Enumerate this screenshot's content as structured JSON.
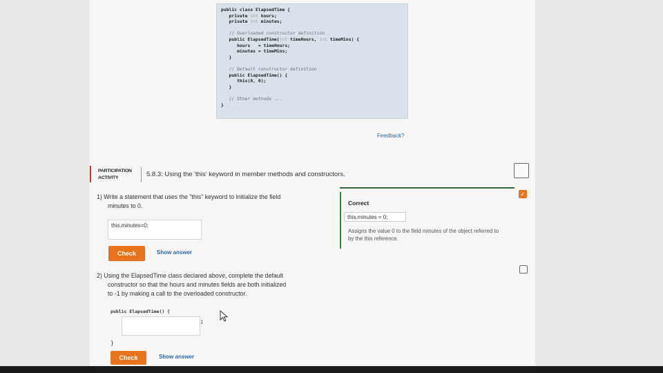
{
  "code": {
    "lines": [
      [
        {
          "t": "public class ElapsedTime {",
          "c": "kw"
        }
      ],
      [
        {
          "t": "   private ",
          "c": "kw"
        },
        {
          "t": "int",
          "c": "ty"
        },
        {
          "t": " hours;",
          "c": "kw"
        }
      ],
      [
        {
          "t": "   private ",
          "c": "kw"
        },
        {
          "t": "int",
          "c": "ty"
        },
        {
          "t": " minutes;",
          "c": "kw"
        }
      ],
      [
        {
          "t": "",
          "c": "kw"
        }
      ],
      [
        {
          "t": "   // Overloaded constructor definition",
          "c": "cm"
        }
      ],
      [
        {
          "t": "   public ElapsedTime(",
          "c": "kw"
        },
        {
          "t": "int",
          "c": "ty"
        },
        {
          "t": " timeHours, ",
          "c": "kw"
        },
        {
          "t": "int",
          "c": "ty"
        },
        {
          "t": " timeMins) {",
          "c": "kw"
        }
      ],
      [
        {
          "t": "      hours   = timeHours;",
          "c": "kw"
        }
      ],
      [
        {
          "t": "      minutes = timeMins;",
          "c": "kw"
        }
      ],
      [
        {
          "t": "   }",
          "c": "kw"
        }
      ],
      [
        {
          "t": "",
          "c": "kw"
        }
      ],
      [
        {
          "t": "   // Default constructor definition",
          "c": "cm"
        }
      ],
      [
        {
          "t": "   public ElapsedTime() {",
          "c": "kw"
        }
      ],
      [
        {
          "t": "      this(0, 0);",
          "c": "kw"
        }
      ],
      [
        {
          "t": "   }",
          "c": "kw"
        }
      ],
      [
        {
          "t": "",
          "c": "kw"
        }
      ],
      [
        {
          "t": "   // Other methods ...",
          "c": "cm"
        }
      ],
      [
        {
          "t": "}",
          "c": "kw"
        }
      ]
    ]
  },
  "feedback_link": "Feedback?",
  "activity": {
    "label_line1": "PARTICIPATION",
    "label_line2": "ACTIVITY",
    "title": "5.8.3: Using the 'this' keyword in member methods and constructors."
  },
  "q1": {
    "number": "1)",
    "text_line1": "Write a statement that uses the \"this\" keyword to initialize the field",
    "text_line2": "minutes to 0.",
    "input_value": "this.minutes=0;",
    "check_label": "Check",
    "show_answer_label": "Show answer"
  },
  "result": {
    "title": "Correct",
    "answer": "this.minutes = 0;",
    "explanation": "Assigns the value 0 to the field minutes of the object referred to by the this reference."
  },
  "q2": {
    "number": "2)",
    "text_line1": "Using the ElapsedTime class declared above, complete the default",
    "text_line2": "constructor so that the hours and minutes fields are both initialized",
    "text_line3": "to -1 by making a call to the overloaded constructor.",
    "code_prefix": "public ElapsedTime() {",
    "semicolon": ";",
    "closing_brace": "}",
    "input_value": "",
    "check_label": "Check",
    "show_answer_label": "Show answer"
  },
  "colors": {
    "accent": "#e7731d",
    "correct": "#2e8a3a",
    "link": "#2a6aa8"
  }
}
